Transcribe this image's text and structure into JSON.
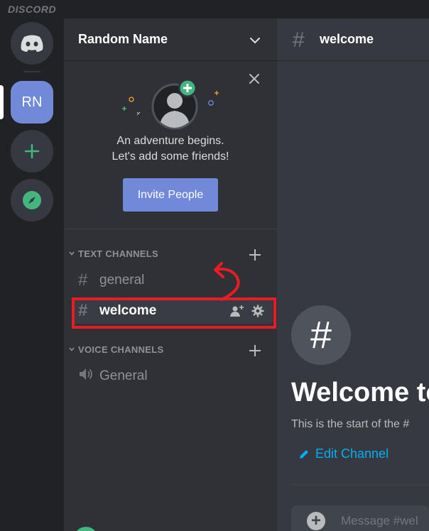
{
  "app": {
    "brand": "DISCORD"
  },
  "servers": {
    "current_initials": "RN"
  },
  "guild": {
    "name": "Random Name"
  },
  "invite": {
    "line1": "An adventure begins.",
    "line2": "Let's add some friends!",
    "button_label": "Invite People"
  },
  "categories": {
    "text": "TEXT CHANNELS",
    "voice": "VOICE CHANNELS"
  },
  "channels": {
    "text": [
      {
        "name": "general"
      },
      {
        "name": "welcome",
        "selected": true
      }
    ],
    "voice": [
      {
        "name": "General"
      }
    ]
  },
  "chat": {
    "channel_name": "welcome",
    "welcome_title": "Welcome to",
    "welcome_sub": "This is the start of the #",
    "edit_channel": "Edit Channel",
    "composer_placeholder": "Message #wel"
  },
  "colors": {
    "accent": "#7289da",
    "online": "#43b581",
    "link": "#00b0f4",
    "annotation": "#e81c24"
  },
  "icons": {
    "home": "discord-logo-icon",
    "add_server": "plus-icon",
    "explore": "compass-icon",
    "chevron": "chevron-down-icon",
    "close": "close-icon",
    "hash": "hash-icon",
    "speaker": "speaker-icon",
    "invite_member": "add-member-icon",
    "settings": "gear-icon",
    "pencil": "pencil-icon"
  }
}
